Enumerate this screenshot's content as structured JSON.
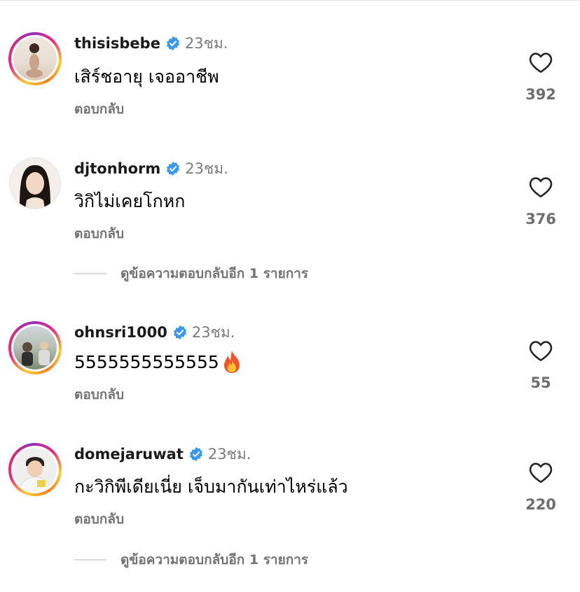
{
  "comments": [
    {
      "username": "thisisbebe",
      "time": "23ชม.",
      "text": "เสิร์ชอายุ เจออาชีพ",
      "reply_label": "ตอบกลับ",
      "likes": "392",
      "ring": "story"
    },
    {
      "username": "djtonhorm",
      "time": "23ชม.",
      "text": "วิกิไม่เคยโกหก",
      "reply_label": "ตอบกลับ",
      "likes": "376",
      "ring": "plain",
      "view_replies": "ดูข้อความตอบกลับอีก 1 รายการ"
    },
    {
      "username": "ohnsri1000",
      "time": "23ชม.",
      "text": "5555555555555",
      "emoji": "fire",
      "reply_label": "ตอบกลับ",
      "likes": "55",
      "ring": "story"
    },
    {
      "username": "domejaruwat",
      "time": "23ชม.",
      "text": "กะวิกิพีเดียเนี่ย เจ็บมากันเท่าไหร่แล้ว",
      "reply_label": "ตอบกลับ",
      "likes": "220",
      "ring": "story",
      "view_replies": "ดูข้อความตอบกลับอีก 1 รายการ"
    }
  ],
  "colors": {
    "verified": "#3897f0",
    "secondary": "#737373"
  },
  "icons": {
    "verified": "verified-badge-icon",
    "like": "heart-outline-icon",
    "emoji": "fire-emoji"
  }
}
